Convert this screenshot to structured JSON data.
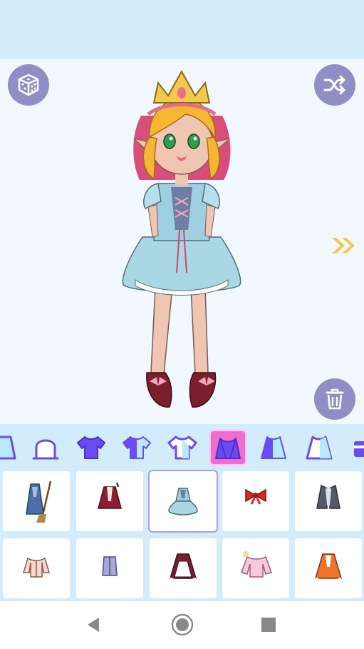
{
  "colors": {
    "top_bar": "#d3ecfc",
    "stage_background": "#f1f8ff",
    "action_button": "#8d8fc5",
    "category_icon": "#6a4bf0",
    "category_active": "#f06ccf",
    "next_arrow": "#f2c94c",
    "nav_icons": "#888888"
  },
  "stage": {
    "buttons": [
      "dice-icon",
      "shuffle-icon",
      "trash-icon",
      "double-chevron-right-icon"
    ],
    "character": "doll-character"
  },
  "categories": [
    {
      "icon": "cape-icon"
    },
    {
      "icon": "hood-icon"
    },
    {
      "icon": "tshirt-icon"
    },
    {
      "icon": "shirt-icon"
    },
    {
      "icon": "jacket-icon"
    },
    {
      "icon": "dress-icon",
      "active": true
    },
    {
      "icon": "coat-icon"
    },
    {
      "icon": "cardigan-icon"
    },
    {
      "icon": "top-icon"
    }
  ],
  "items": [
    {
      "icon": "witch-dress-broom-item"
    },
    {
      "icon": "maroon-dress-item"
    },
    {
      "icon": "blue-dress-item",
      "selected": true
    },
    {
      "icon": "red-bow-item"
    },
    {
      "icon": "gray-jacket-item"
    },
    {
      "icon": "peach-blouse-item"
    },
    {
      "icon": "lavender-vest-item"
    },
    {
      "icon": "maid-dress-item"
    },
    {
      "icon": "pink-blouse-item"
    },
    {
      "icon": "orange-dress-item"
    }
  ],
  "nav": [
    "back-icon",
    "home-icon",
    "recents-icon"
  ]
}
